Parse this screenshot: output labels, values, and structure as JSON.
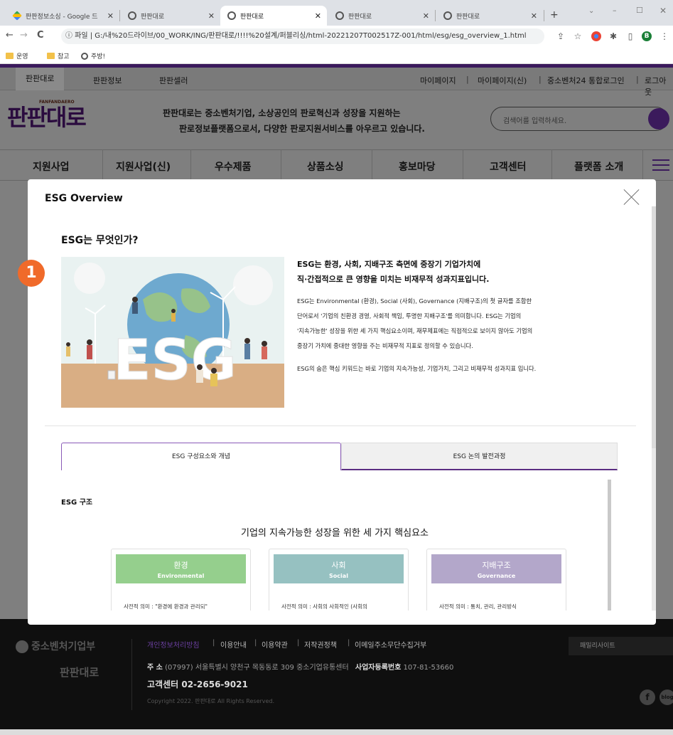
{
  "browser": {
    "tabs": [
      {
        "label": "판판정보소싱 - Google 드",
        "active": false
      },
      {
        "label": "판판대로",
        "active": false
      },
      {
        "label": "판판대로",
        "active": true
      },
      {
        "label": "판판대로",
        "active": false
      },
      {
        "label": "판판대로",
        "active": false
      }
    ],
    "new_tab": "+",
    "address": "ⓘ 파일  |  G:/내%20드라이브/00_WORK/ING/판판대로/!!!!%20설계/퍼블리싱/html-20221207T002517Z-001/html/esg/esg_overview_1.html",
    "profile": "B",
    "bookmarks": [
      "운영",
      "참고",
      "주방!"
    ]
  },
  "site": {
    "top_left": [
      "판판대로",
      "판판정보",
      "판판셀러"
    ],
    "top_right": [
      "마이페이지",
      "|",
      "마이페이지(신)",
      "|",
      "중소벤처24 통합로그인",
      "|",
      "로그아웃"
    ],
    "logo": "판판대로",
    "logo_sub": "FANFANDAERO",
    "slogan_line1": "판판대로는 중소벤처기업, 소상공인의 판로혁신과 성장을 지원하는",
    "slogan_line2": "판로정보플랫폼으로서, 다양한 판로지원서비스를 아우르고 있습니다.",
    "search_placeholder": "검색어를 입력하세요.",
    "nav": [
      "지원사업",
      "지원사업(신)",
      "우수제품",
      "상품소싱",
      "홍보마당",
      "고객센터",
      "플랫폼 소개"
    ]
  },
  "modal": {
    "title": "ESG Overview",
    "section_title": "ESG는 무엇인가?",
    "badge": "1",
    "illustration_text": "ESG",
    "lead_line1": "ESG는 환경, 사회, 지배구조 측면에 중장기 기업가치에",
    "lead_line2": "직·간접적으로 큰 영향을 미치는 비재무적 성과지표입니다.",
    "body_lines": [
      "ESG는 Environmental (환경), Social (사회), Governance (지배구조)의 첫 글자를 조합한",
      "단어로서 '기업의 친환경 경영, 사회적 책임, 투명한 지배구조'를 의미합니다. ESG는 기업의",
      "'지속가능한' 성장을 위한 세 가지 핵심요소이며, 재무제표에는 직접적으로 보이지 않아도 기업의",
      "중장기 가치에 중대한 영향을 주는 비재무적 지표로 정의할 수 있습니다."
    ],
    "body_last": "ESG의 숨은 핵심 키워드는 바로 기업의 지속가능성, 기업가치, 그리고 비재무적 성과지표 입니다.",
    "tabs": [
      "ESG 구성요소와 개념",
      "ESG 논의 발전과정"
    ],
    "structure_title": "ESG 구조",
    "core_title": "기업의 지속가능한 성장을 위한 세 가지 핵심요소",
    "cards": [
      {
        "ko": "환경",
        "en": "Environmental",
        "color": "#95cf8d",
        "desc": "사전적 의미 : \"환경에 환경과 관리되\""
      },
      {
        "ko": "사회",
        "en": "Social",
        "color": "#96c1c1",
        "desc": "사전적 의미 : 사회의 사회적인 (사회의"
      },
      {
        "ko": "지배구조",
        "en": "Governance",
        "color": "#b3a7ca",
        "desc": "사전적 의미 : 통치, 관리, 관리방식"
      }
    ]
  },
  "footer": {
    "org": "중소벤처기업부",
    "logo": "판판대로",
    "links": [
      "개인정보처리방침",
      "|",
      "이용안내",
      "|",
      "이용약관",
      "|",
      "저작권정책",
      "|",
      "이메일주소무단수집거부"
    ],
    "address_label": "주 소",
    "address": "(07997) 서울특별시 양천구 목동동로 309 중소기업유통센터",
    "biz_label": "사업자등록번호",
    "biz_no": "107-81-53660",
    "cs": "고객센터  02-2656-9021",
    "copyright": "Copyright 2022. 판판대로 All Rights Reserved.",
    "family_site": "패밀리사이트",
    "social": [
      "f",
      "blog"
    ]
  }
}
